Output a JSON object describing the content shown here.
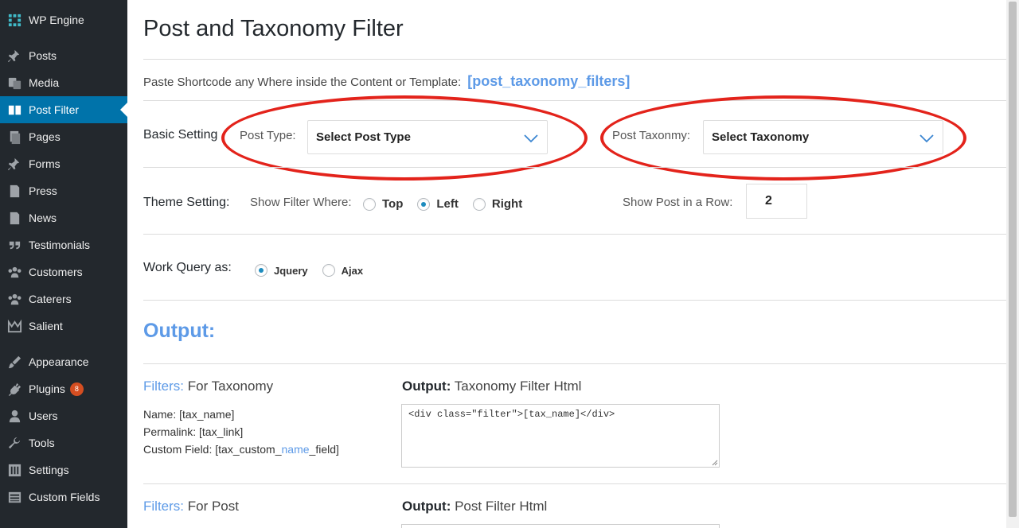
{
  "sidebar": {
    "brand": "WP Engine",
    "items": [
      {
        "label": "Posts",
        "icon": "pin-icon"
      },
      {
        "label": "Media",
        "icon": "media-icon"
      },
      {
        "label": "Post Filter",
        "icon": "book-icon"
      },
      {
        "label": "Pages",
        "icon": "pages-icon"
      },
      {
        "label": "Forms",
        "icon": "pin-icon"
      },
      {
        "label": "Press",
        "icon": "document-icon"
      },
      {
        "label": "News",
        "icon": "document-icon"
      },
      {
        "label": "Testimonials",
        "icon": "quote-icon"
      },
      {
        "label": "Customers",
        "icon": "groups-icon"
      },
      {
        "label": "Caterers",
        "icon": "groups-icon"
      },
      {
        "label": "Salient",
        "icon": "crown-icon"
      },
      {
        "label": "Appearance",
        "icon": "brush-icon"
      },
      {
        "label": "Plugins",
        "icon": "plug-icon",
        "badge": "8"
      },
      {
        "label": "Users",
        "icon": "user-icon"
      },
      {
        "label": "Tools",
        "icon": "wrench-icon"
      },
      {
        "label": "Settings",
        "icon": "settings-icon"
      },
      {
        "label": "Custom Fields",
        "icon": "table-icon"
      }
    ],
    "active": "Post Filter"
  },
  "page": {
    "title": "Post and Taxonomy Filter",
    "shortcode_label": "Paste Shortcode any Where inside the Content or Template:",
    "shortcode": "[post_taxonomy_filters]"
  },
  "basic": {
    "label": "Basic Setting",
    "post_type_label": "Post Type:",
    "post_type_value": "Select Post Type",
    "taxonomy_label": "Post Taxonmy:",
    "taxonomy_value": "Select Taxonomy"
  },
  "theme": {
    "label": "Theme Setting:",
    "show_where_label": "Show Filter Where:",
    "options": [
      "Top",
      "Left",
      "Right"
    ],
    "selected": "Left",
    "row_label": "Show Post in a Row:",
    "row_value": "2"
  },
  "query": {
    "label": "Work Query as:",
    "options": [
      "Jquery",
      "Ajax"
    ],
    "selected": "Jquery"
  },
  "output": {
    "heading": "Output:",
    "tax": {
      "filters_key": "Filters:",
      "filters_val": "For Taxonomy",
      "output_key": "Output:",
      "output_val": "Taxonomy Filter Html",
      "name": "Name: [tax_name]",
      "permalink": "Permalink: [tax_link]",
      "custom_pre": "Custom Field: [tax_custom_",
      "custom_mid": "name",
      "custom_post": "_field]",
      "html": "<div class=\"filter\">[tax_name]</div>"
    },
    "post": {
      "filters_key": "Filters:",
      "filters_val": "For Post",
      "output_key": "Output:",
      "output_val": "Post Filter Html"
    }
  },
  "colors": {
    "accent": "#5d9ae7",
    "sidebar": "#23282d",
    "active": "#0073aa",
    "annotation": "#e3231b"
  }
}
